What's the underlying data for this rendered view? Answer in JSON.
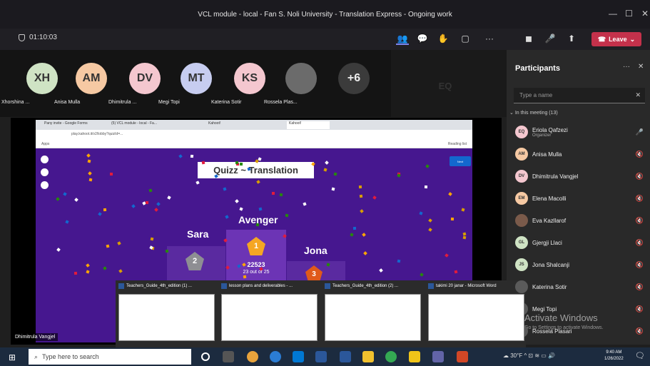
{
  "window": {
    "title": "VCL module - local - Fan S. Noli University - Translation Express - Ongoing work"
  },
  "meeting": {
    "timer": "01:10:03",
    "leave_label": "Leave"
  },
  "attendees": [
    {
      "initials": "XH",
      "name": "Xhorshina ...",
      "color": "#cfe3c4"
    },
    {
      "initials": "AM",
      "name": "Anisa Mulla",
      "color": "#f6c9a3"
    },
    {
      "initials": "DV",
      "name": "Dhimitrula ...",
      "color": "#f4c7cf"
    },
    {
      "initials": "MT",
      "name": "Megi Topi",
      "color": "#c7cdf0"
    },
    {
      "initials": "KS",
      "name": "Katerina Sotir",
      "color": "#f4c7cf"
    },
    {
      "initials": "",
      "name": "Rossela Plas...",
      "color": "#6b6b6b"
    },
    {
      "initials": "+6",
      "name": "",
      "color": "#3b3b3b"
    }
  ],
  "presenter_tile": {
    "initials": "EQ",
    "color": "#f4c7cf"
  },
  "shared_screen": {
    "browser_tabs": [
      "Pany invite - Google Forms",
      "(5) VCL module - local - Fa...",
      "Kahoot!",
      "Kahoot!"
    ],
    "url": "play.kahoot.it/v2/lobby?quizId=...",
    "bookmark": "Apps",
    "reading_list": "Reading list",
    "quiz_title": "Quizz ~ Translation",
    "next_label": "Next",
    "podium": [
      {
        "name": "Avenger",
        "rank": "1",
        "score": "22523",
        "detail": "23 out of 25"
      },
      {
        "name": "Sara",
        "rank": "2"
      },
      {
        "name": "Jona",
        "rank": "3"
      }
    ]
  },
  "presenter_label": "Dhimitrula Vangjel",
  "participants_panel": {
    "title": "Participants",
    "search_placeholder": "Type a name",
    "group_label": "In this meeting (13)",
    "people": [
      {
        "initials": "EQ",
        "name": "Eriola Qafzezi",
        "sub": "Organizer",
        "color": "#f4c7cf"
      },
      {
        "initials": "AM",
        "name": "Anisa Mulla",
        "sub": "",
        "color": "#f6c9a3"
      },
      {
        "initials": "DV",
        "name": "Dhimitrula Vangjel",
        "sub": "",
        "color": "#f4c7cf"
      },
      {
        "initials": "EM",
        "name": "Elena Macolli",
        "sub": "",
        "color": "#f6c9a3"
      },
      {
        "initials": "",
        "name": "Eva Kazllarof",
        "sub": "",
        "color": "#7a5a4a"
      },
      {
        "initials": "GL",
        "name": "Gjergji Llaci",
        "sub": "",
        "color": "#cfe3c4"
      },
      {
        "initials": "JS",
        "name": "Jona Shalcanji",
        "sub": "",
        "color": "#cfe3c4"
      },
      {
        "initials": "",
        "name": "Katerina Sotir",
        "sub": "",
        "color": "#5a5a5a"
      },
      {
        "initials": "",
        "name": "Megi Topi",
        "sub": "",
        "color": "#5a5a5a"
      },
      {
        "initials": "",
        "name": "Rossela Plasari",
        "sub": "",
        "color": "#5a5a5a"
      }
    ]
  },
  "taskbar_previews": [
    "Teachers_Guide_4th_edition (1) ...",
    "lesson plans and deliverables - ...",
    "Teachers_Guide_4th_edition (2) ...",
    "takimi 20 janar - Microsoft Word"
  ],
  "watermark": {
    "line1": "Activate Windows",
    "line2": "Go to Settings to activate Windows."
  },
  "taskbar": {
    "search_placeholder": "Type here to search",
    "weather": "30°F",
    "time": "9:40 AM",
    "date": "1/26/2022"
  }
}
